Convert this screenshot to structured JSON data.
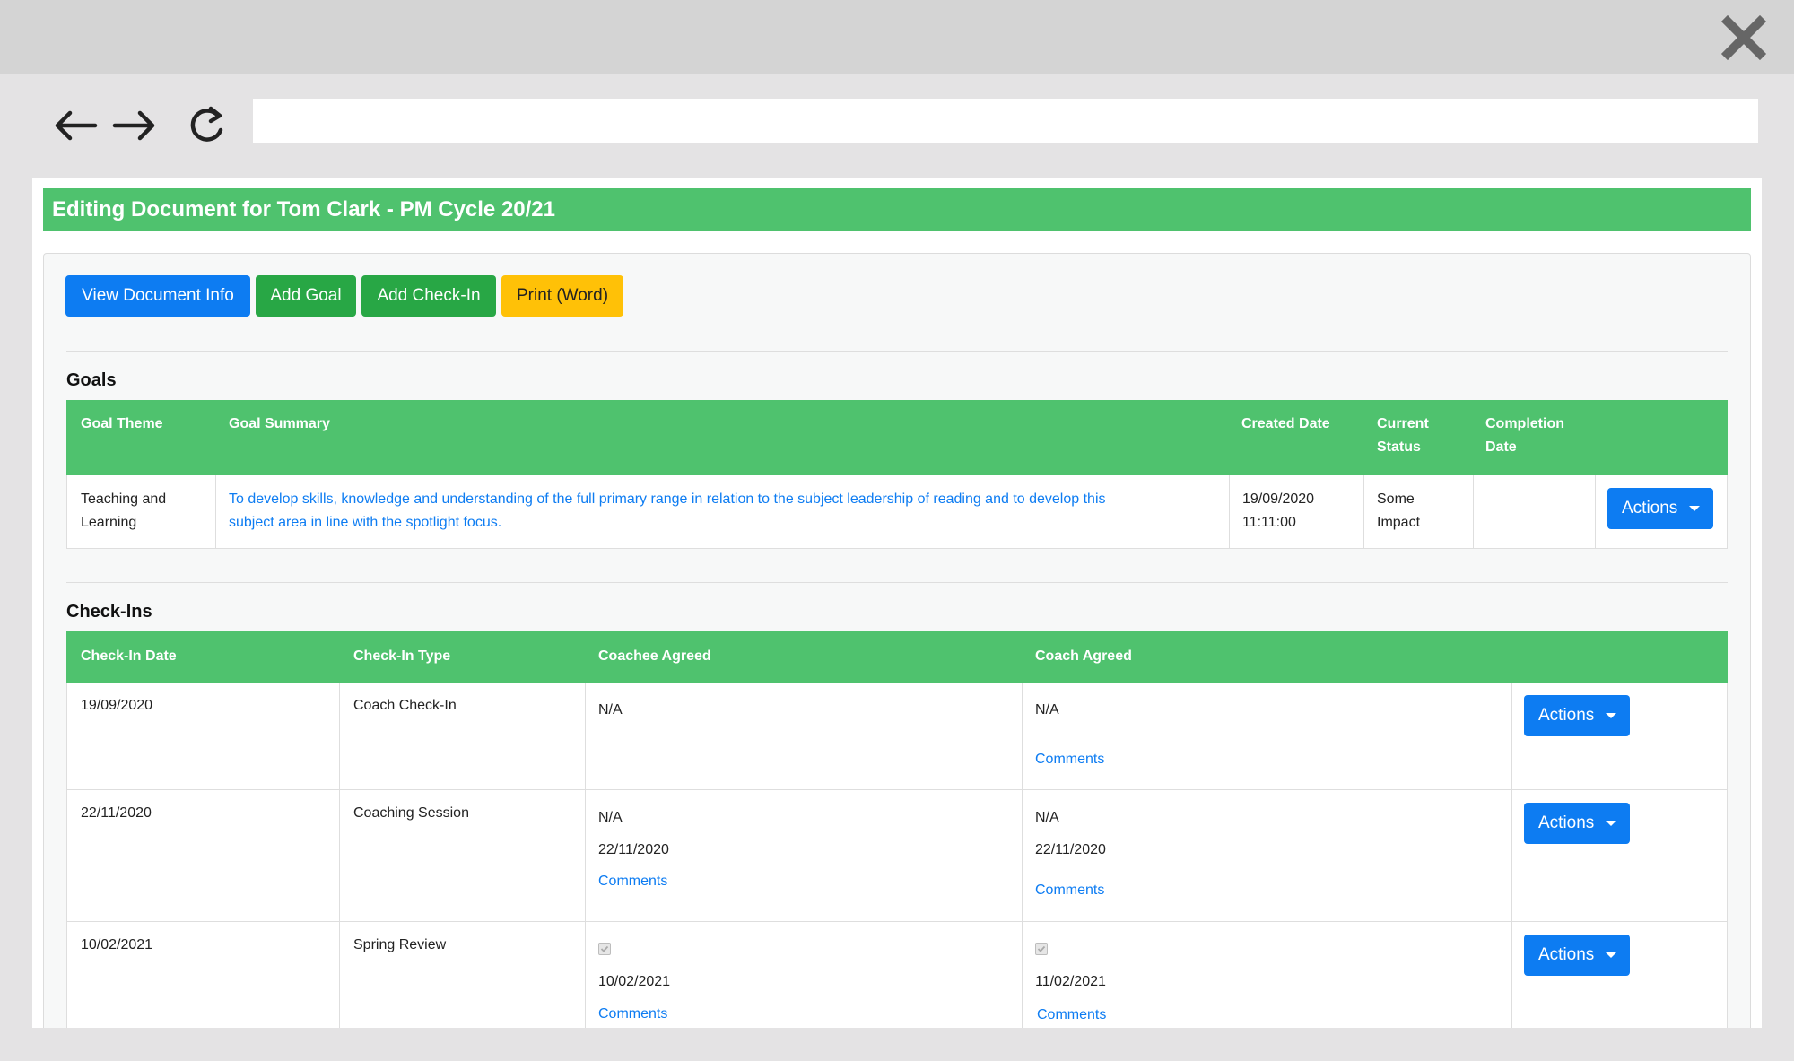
{
  "document": {
    "title": "Editing Document for Tom Clark - PM Cycle 20/21"
  },
  "toolbar_buttons": {
    "view_info": "View Document Info",
    "add_goal": "Add Goal",
    "add_checkin": "Add Check-In",
    "print_word": "Print (Word)"
  },
  "goals": {
    "title": "Goals",
    "headers": {
      "theme": "Goal Theme",
      "summary": "Goal Summary",
      "created": "Created Date",
      "status_l1": "Current",
      "status_l2": "Status",
      "completion_l1": "Completion",
      "completion_l2": "Date"
    },
    "rows": [
      {
        "theme_l1": "Teaching and",
        "theme_l2": "Learning",
        "summary_l1": "To develop skills, knowledge and understanding of the full primary range in relation to the subject leadership of reading and to develop this",
        "summary_l2": "subject area in line with the spotlight focus.",
        "created_l1": "19/09/2020",
        "created_l2": "11:11:00",
        "status_l1": "Some",
        "status_l2": "Impact",
        "completion": "",
        "actions": "Actions"
      }
    ]
  },
  "checkins": {
    "title": "Check-Ins",
    "headers": {
      "date": "Check-In Date",
      "type": "Check-In Type",
      "coachee": "Coachee Agreed",
      "coach": "Coach Agreed"
    },
    "rows": [
      {
        "date": "19/09/2020",
        "type": "Coach Check-In",
        "coachee_status": "N/A",
        "coach_status": "N/A",
        "coach_comments": "Comments",
        "actions": "Actions"
      },
      {
        "date": "22/11/2020",
        "type": "Coaching Session",
        "coachee_status": "N/A",
        "coachee_date": "22/11/2020",
        "coachee_comments": "Comments",
        "coach_status": "N/A",
        "coach_date": "22/11/2020",
        "coach_comments": "Comments",
        "actions": "Actions"
      },
      {
        "date": "10/02/2021",
        "type": "Spring Review",
        "coachee_checked": true,
        "coachee_date": "10/02/2021",
        "coachee_comments": "Comments",
        "coach_checked": true,
        "coach_date": "11/02/2021",
        "coach_comments": "Comments",
        "actions": "Actions"
      }
    ]
  },
  "colors": {
    "header_green": "#4fc26e",
    "primary_blue": "#0d7cf2",
    "success_green": "#28a745",
    "warning_yellow": "#ffc107"
  },
  "icons": {
    "close": "close-icon",
    "back": "arrow-left-icon",
    "forward": "arrow-right-icon",
    "reload": "reload-icon",
    "caret": "caret-down-icon"
  }
}
